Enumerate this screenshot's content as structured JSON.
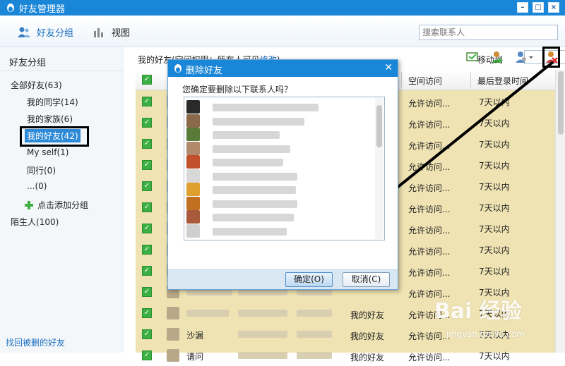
{
  "window": {
    "title": "好友管理器",
    "controls": [
      "–",
      "□",
      "×"
    ]
  },
  "toolbar": {
    "tab_groups": "好友分组",
    "tab_view": "视图",
    "search_placeholder": "搜索联系人"
  },
  "sidebar": {
    "header": "好友分组",
    "all_friends": "全部好友(63)",
    "groups": [
      {
        "label": "我的同学(14)"
      },
      {
        "label": "我的家族(6)"
      },
      {
        "label": "我的好友(42)",
        "selected": true
      },
      {
        "label": "My self(1)"
      },
      {
        "label": "同行(0)"
      },
      {
        "label": "...(0)"
      }
    ],
    "add_group": "点击添加分组",
    "strangers": "陌生人(100)",
    "recover": "找回被删的好友"
  },
  "main": {
    "title_prefix": "我的好友(空间权限：所有人可见",
    "title_link": "修改",
    "title_suffix": ")",
    "move_to": "移动到",
    "move_value": "",
    "columns": [
      "空间访问",
      "最后登录时间"
    ],
    "rows": [
      {
        "group": "",
        "access": "允许访问...",
        "last_login": "7天以内"
      },
      {
        "group": "",
        "access": "允许访问...",
        "last_login": "7天以内"
      },
      {
        "group": "",
        "access": "允许访问...",
        "last_login": "7天以内"
      },
      {
        "group": "",
        "access": "允许访问...",
        "last_login": "7天以内"
      },
      {
        "group": "",
        "access": "允许访问...",
        "last_login": "7天以内"
      },
      {
        "group": "",
        "access": "允许访问...",
        "last_login": "7天以内"
      },
      {
        "group": "",
        "access": "允许访问...",
        "last_login": "7天以内"
      },
      {
        "group": "",
        "access": "允许访问...",
        "last_login": "7天以内"
      },
      {
        "group": "",
        "access": "允许访问...",
        "last_login": "7天以内"
      },
      {
        "group": "",
        "access": "允许访问...",
        "last_login": "7天以内"
      },
      {
        "group": "我的好友",
        "access": "允许访问...",
        "last_login": "7天以内"
      },
      {
        "name": "沙漏",
        "group": "我的好友",
        "access": "允许访问...",
        "last_login": "7天以内"
      },
      {
        "name": "请问",
        "group": "我的好友",
        "access": "允许访问...",
        "last_login": "7天以内"
      }
    ]
  },
  "dialog": {
    "title": "删除好友",
    "close": "✕",
    "message": "您确定要删除以下联系人吗？",
    "contacts": [
      {
        "avatar_color": "#2a2a2a"
      },
      {
        "avatar_color": "#8a6a4a"
      },
      {
        "avatar_color": "#5a7a3a"
      },
      {
        "avatar_color": "#b08a6a"
      },
      {
        "avatar_color": "#c2502a"
      },
      {
        "avatar_color": "#d8d8d8"
      },
      {
        "avatar_color": "#e0a030"
      },
      {
        "avatar_color": "#c07020"
      },
      {
        "avatar_color": "#a85a3a"
      },
      {
        "avatar_color": "#cfcfcf"
      }
    ],
    "ok": "确定(O)",
    "cancel": "取消(C)"
  },
  "watermark": {
    "main": "Bai 经验",
    "sub": "jingyan.baidu.com"
  },
  "colors": {
    "titlebar": "#1a86d8",
    "table_bg": "#efe3b3",
    "check": "#3cb043",
    "link": "#1a6fc0"
  }
}
